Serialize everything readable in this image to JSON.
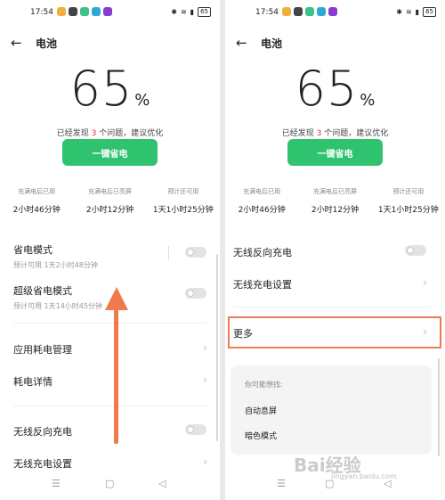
{
  "status_bar": {
    "time": "17:54",
    "battery": "65"
  },
  "header": {
    "back_icon": "←",
    "title": "电池"
  },
  "battery": {
    "percent": "65",
    "sign": "%"
  },
  "issue": {
    "prefix": "已经发现 ",
    "count": "3",
    "suffix": " 个问题，建议优化"
  },
  "save_button": "一键省电",
  "stats": [
    {
      "label": "充满电后已用",
      "value": "2小时46分钟"
    },
    {
      "label": "充满电后已亮屏",
      "value": "2小时12分钟"
    },
    {
      "label": "预计还可用",
      "value": "1天1小时25分钟"
    }
  ],
  "left_list": {
    "power_saving": {
      "title": "省电模式",
      "sub": "预计可用 1天2小时48分钟"
    },
    "super_saving": {
      "title": "超级省电模式",
      "sub": "预计可用 1天14小时45分钟"
    },
    "app_usage": "应用耗电管理",
    "usage_details": "耗电详情",
    "reverse_charge": "无线反向充电",
    "wireless_settings": "无线充电设置"
  },
  "right_list": {
    "reverse_charge": "无线反向充电",
    "wireless_settings": "无线充电设置",
    "more": "更多",
    "suggest_head": "你可能想找:",
    "suggest_items": [
      "自动息屏",
      "暗色模式"
    ]
  },
  "nav": {
    "menu": "☰",
    "home": "▢",
    "back": "◁"
  },
  "watermark": {
    "main": "Bai经验",
    "sub": "jingyan.baidu.com"
  },
  "colors": {
    "accent_green": "#2fc26f",
    "highlight": "#ef7b55",
    "arrow": "#f07a4e",
    "issue_red": "#e0302a"
  }
}
